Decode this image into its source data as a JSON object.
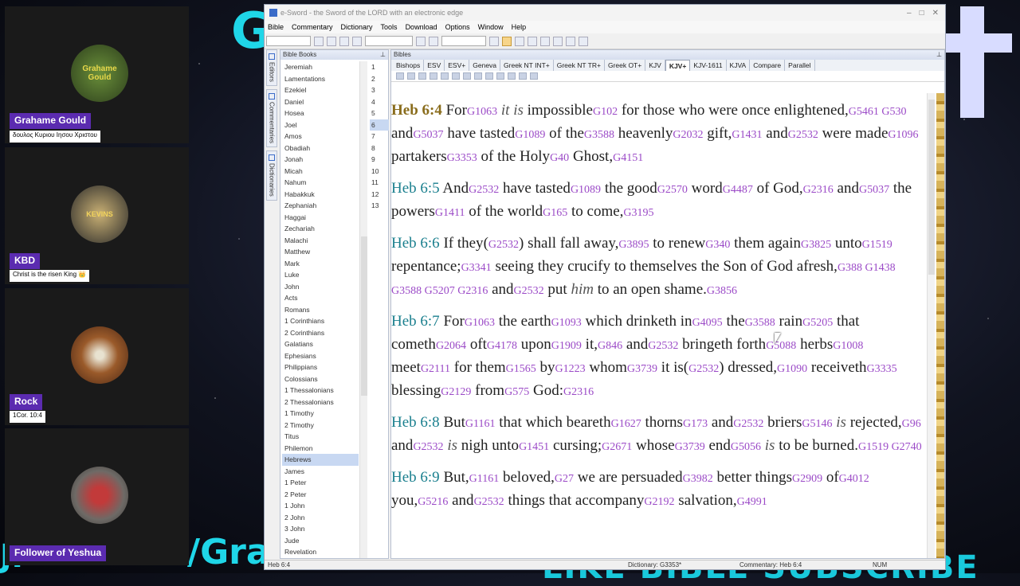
{
  "background": {
    "top_left_text": "G",
    "bottom_left_text": "/Gra",
    "bottom_right_text": "LIKE BIBLE SUBSCRIBE",
    "left_text": "Jl"
  },
  "participants": [
    {
      "name": "Grahame Gould",
      "status": "δουλος Κυριου Ιησου Χριστου",
      "avatar_text": "Grahame Gould"
    },
    {
      "name": "KBD",
      "status": "Christ is the risen King 👑",
      "avatar_text": "KEVINS"
    },
    {
      "name": "Rock",
      "status": "1Cor. 10:4",
      "avatar_text": ""
    },
    {
      "name": "Follower of Yeshua",
      "status": "",
      "avatar_text": ""
    }
  ],
  "window": {
    "title": "e-Sword - the Sword of the LORD with an electronic edge",
    "menu": [
      "Bible",
      "Commentary",
      "Dictionary",
      "Tools",
      "Download",
      "Options",
      "Window",
      "Help"
    ]
  },
  "side_tabs": [
    "Editors",
    "Commentaries",
    "Dictionaries"
  ],
  "books_panel": {
    "title": "Bible Books",
    "books": [
      "Jeremiah",
      "Lamentations",
      "Ezekiel",
      "Daniel",
      "Hosea",
      "Joel",
      "Amos",
      "Obadiah",
      "Jonah",
      "Micah",
      "Nahum",
      "Habakkuk",
      "Zephaniah",
      "Haggai",
      "Zechariah",
      "Malachi",
      "Matthew",
      "Mark",
      "Luke",
      "John",
      "Acts",
      "Romans",
      "1 Corinthians",
      "2 Corinthians",
      "Galatians",
      "Ephesians",
      "Philippians",
      "Colossians",
      "1 Thessalonians",
      "2 Thessalonians",
      "1 Timothy",
      "2 Timothy",
      "Titus",
      "Philemon",
      "Hebrews",
      "James",
      "1 Peter",
      "2 Peter",
      "1 John",
      "2 John",
      "3 John",
      "Jude",
      "Revelation"
    ],
    "selected_book": "Hebrews",
    "chapters": [
      "1",
      "2",
      "3",
      "4",
      "5",
      "6",
      "7",
      "8",
      "9",
      "10",
      "11",
      "12",
      "13"
    ],
    "selected_chapter": "6"
  },
  "bibles_panel": {
    "title": "Bibles",
    "tabs": [
      "Bishops",
      "ESV",
      "ESV+",
      "Geneva",
      "Greek NT INT+",
      "Greek NT TR+",
      "Greek OT+",
      "KJV",
      "KJV+",
      "KJV-1611",
      "KJVA",
      "Compare",
      "Parallel"
    ],
    "active_tab": "KJV+"
  },
  "verses": [
    {
      "ref": "Heb 6:4",
      "current": true,
      "segments": [
        [
          "t",
          " For"
        ],
        [
          "s",
          "G1063"
        ],
        [
          "i",
          " it is"
        ],
        [
          "t",
          " impossible"
        ],
        [
          "s",
          "G102"
        ],
        [
          "t",
          " for those who were once enlightened,"
        ],
        [
          "s",
          "G5461 G530"
        ],
        [
          "t",
          " and"
        ],
        [
          "s",
          "G5037"
        ],
        [
          "t",
          " have tasted"
        ],
        [
          "s",
          "G1089"
        ],
        [
          "t",
          " of the"
        ],
        [
          "s",
          "G3588"
        ],
        [
          "t",
          " heavenly"
        ],
        [
          "s",
          "G2032"
        ],
        [
          "t",
          " gift,"
        ],
        [
          "s",
          "G1431"
        ],
        [
          "t",
          " and"
        ],
        [
          "s",
          "G2532"
        ],
        [
          "t",
          " were made"
        ],
        [
          "s",
          "G1096"
        ],
        [
          "t",
          " partakers"
        ],
        [
          "s",
          "G3353"
        ],
        [
          "t",
          " of the Holy"
        ],
        [
          "s",
          "G40"
        ],
        [
          "t",
          " Ghost,"
        ],
        [
          "s",
          "G4151"
        ]
      ]
    },
    {
      "ref": "Heb 6:5",
      "current": false,
      "segments": [
        [
          "t",
          " And"
        ],
        [
          "s",
          "G2532"
        ],
        [
          "t",
          " have tasted"
        ],
        [
          "s",
          "G1089"
        ],
        [
          "t",
          " the good"
        ],
        [
          "s",
          "G2570"
        ],
        [
          "t",
          " word"
        ],
        [
          "s",
          "G4487"
        ],
        [
          "t",
          " of God,"
        ],
        [
          "s",
          "G2316"
        ],
        [
          "t",
          " and"
        ],
        [
          "s",
          "G5037"
        ],
        [
          "t",
          " the powers"
        ],
        [
          "s",
          "G1411"
        ],
        [
          "t",
          " of the world"
        ],
        [
          "s",
          "G165"
        ],
        [
          "t",
          " to come,"
        ],
        [
          "s",
          "G3195"
        ]
      ]
    },
    {
      "ref": "Heb 6:6",
      "current": false,
      "segments": [
        [
          "t",
          " If they"
        ],
        [
          "t",
          "("
        ],
        [
          "s",
          "G2532"
        ],
        [
          "t",
          ") shall fall away,"
        ],
        [
          "s",
          "G3895"
        ],
        [
          "t",
          " to renew"
        ],
        [
          "s",
          "G340"
        ],
        [
          "t",
          " them again"
        ],
        [
          "s",
          "G3825"
        ],
        [
          "t",
          " unto"
        ],
        [
          "s",
          "G1519"
        ],
        [
          "t",
          " repentance;"
        ],
        [
          "s",
          "G3341"
        ],
        [
          "t",
          " seeing they crucify to themselves the Son of God afresh,"
        ],
        [
          "s",
          "G388 G1438 G3588 G5207 G2316"
        ],
        [
          "t",
          " and"
        ],
        [
          "s",
          "G2532"
        ],
        [
          "t",
          " put "
        ],
        [
          "i",
          "him"
        ],
        [
          "t",
          " to an open shame."
        ],
        [
          "s",
          "G3856"
        ]
      ]
    },
    {
      "ref": "Heb 6:7",
      "current": false,
      "segments": [
        [
          "t",
          " For"
        ],
        [
          "s",
          "G1063"
        ],
        [
          "t",
          " the earth"
        ],
        [
          "s",
          "G1093"
        ],
        [
          "t",
          " which drinketh in"
        ],
        [
          "s",
          "G4095"
        ],
        [
          "t",
          " the"
        ],
        [
          "s",
          "G3588"
        ],
        [
          "t",
          " rain"
        ],
        [
          "s",
          "G5205"
        ],
        [
          "t",
          " that cometh"
        ],
        [
          "s",
          "G2064"
        ],
        [
          "t",
          " oft"
        ],
        [
          "s",
          "G4178"
        ],
        [
          "t",
          " upon"
        ],
        [
          "s",
          "G1909"
        ],
        [
          "t",
          " it,"
        ],
        [
          "s",
          "G846"
        ],
        [
          "t",
          " and"
        ],
        [
          "s",
          "G2532"
        ],
        [
          "t",
          " bringeth forth"
        ],
        [
          "s",
          "G5088"
        ],
        [
          "t",
          " herbs"
        ],
        [
          "s",
          "G1008"
        ],
        [
          "t",
          " meet"
        ],
        [
          "s",
          "G2111"
        ],
        [
          "t",
          " for them"
        ],
        [
          "s",
          "G1565"
        ],
        [
          "t",
          " by"
        ],
        [
          "s",
          "G1223"
        ],
        [
          "t",
          " whom"
        ],
        [
          "s",
          "G3739"
        ],
        [
          "t",
          " it is("
        ],
        [
          "s",
          "G2532"
        ],
        [
          "t",
          ") dressed,"
        ],
        [
          "s",
          "G1090"
        ],
        [
          "t",
          " receiveth"
        ],
        [
          "s",
          "G3335"
        ],
        [
          "t",
          " blessing"
        ],
        [
          "s",
          "G2129"
        ],
        [
          "t",
          " from"
        ],
        [
          "s",
          "G575"
        ],
        [
          "t",
          " God:"
        ],
        [
          "s",
          "G2316"
        ]
      ]
    },
    {
      "ref": "Heb 6:8",
      "current": false,
      "segments": [
        [
          "t",
          " But"
        ],
        [
          "s",
          "G1161"
        ],
        [
          "t",
          " that which beareth"
        ],
        [
          "s",
          "G1627"
        ],
        [
          "t",
          " thorns"
        ],
        [
          "s",
          "G173"
        ],
        [
          "t",
          " and"
        ],
        [
          "s",
          "G2532"
        ],
        [
          "t",
          " briers"
        ],
        [
          "s",
          "G5146"
        ],
        [
          "i",
          " is"
        ],
        [
          "t",
          " rejected,"
        ],
        [
          "s",
          "G96"
        ],
        [
          "t",
          " and"
        ],
        [
          "s",
          "G2532"
        ],
        [
          "i",
          " is"
        ],
        [
          "t",
          " nigh unto"
        ],
        [
          "s",
          "G1451"
        ],
        [
          "t",
          " cursing;"
        ],
        [
          "s",
          "G2671"
        ],
        [
          "t",
          " whose"
        ],
        [
          "s",
          "G3739"
        ],
        [
          "t",
          " end"
        ],
        [
          "s",
          "G5056"
        ],
        [
          "i",
          " is"
        ],
        [
          "t",
          " to be burned."
        ],
        [
          "s",
          "G1519 G2740"
        ]
      ]
    },
    {
      "ref": "Heb 6:9",
      "current": false,
      "segments": [
        [
          "t",
          " But,"
        ],
        [
          "s",
          "G1161"
        ],
        [
          "t",
          " beloved,"
        ],
        [
          "s",
          "G27"
        ],
        [
          "t",
          " we are persuaded"
        ],
        [
          "s",
          "G3982"
        ],
        [
          "t",
          " better things"
        ],
        [
          "s",
          "G2909"
        ],
        [
          "t",
          " of"
        ],
        [
          "s",
          "G4012"
        ],
        [
          "t",
          " you,"
        ],
        [
          "s",
          "G5216"
        ],
        [
          "t",
          " and"
        ],
        [
          "s",
          "G2532"
        ],
        [
          "t",
          " things that accompany"
        ],
        [
          "s",
          "G2192"
        ],
        [
          "t",
          " salvation,"
        ],
        [
          "s",
          "G4991"
        ]
      ]
    }
  ],
  "statusbar": {
    "bible": "Heb 6:4",
    "dictionary": "Dictionary: G3353*",
    "commentary": "Commentary: Heb 6:4",
    "num": "NUM"
  },
  "colors": {
    "strongs": "#9b4ac7",
    "verse_ref": "#1a7f8e",
    "current_ref": "#8a6d1d",
    "name_badge": "#5b2bb0",
    "overlay_cyan": "#1fd6e8"
  }
}
